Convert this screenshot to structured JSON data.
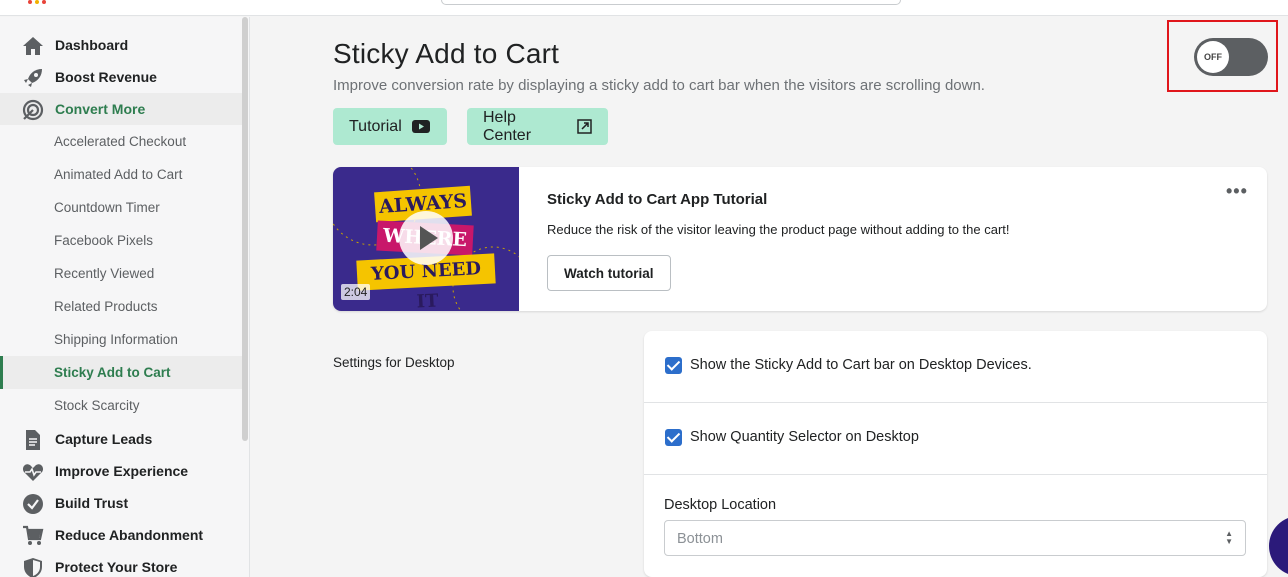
{
  "sidebar": {
    "items": [
      {
        "label": "Dashboard",
        "icon": "home-icon"
      },
      {
        "label": "Boost Revenue",
        "icon": "rocket-icon"
      },
      {
        "label": "Convert More",
        "icon": "target-icon",
        "active": true
      },
      {
        "label": "Capture Leads",
        "icon": "document-icon"
      },
      {
        "label": "Improve Experience",
        "icon": "heartbeat-icon"
      },
      {
        "label": "Build Trust",
        "icon": "badge-check-icon"
      },
      {
        "label": "Reduce Abandonment",
        "icon": "cart-icon"
      },
      {
        "label": "Protect Your Store",
        "icon": "shield-icon"
      }
    ],
    "subitems": [
      "Accelerated Checkout",
      "Animated Add to Cart",
      "Countdown Timer",
      "Facebook Pixels",
      "Recently Viewed",
      "Related Products",
      "Shipping Information",
      "Sticky Add to Cart",
      "Stock Scarcity"
    ],
    "selected_subitem": "Sticky Add to Cart"
  },
  "header": {
    "title": "Sticky Add to Cart",
    "subtitle": "Improve conversion rate by displaying a sticky add to cart bar when the visitors are scrolling down.",
    "tutorial_label": "Tutorial",
    "help_label": "Help Center",
    "toggle_label": "OFF"
  },
  "video_card": {
    "title": "Sticky Add to Cart App Tutorial",
    "description": "Reduce the risk of the visitor leaving the product page without adding to the cart!",
    "button_label": "Watch tutorial",
    "duration": "2:04",
    "thumb_lines": [
      "ALWAYS",
      "WHERE",
      "YOU NEED IT"
    ],
    "more_label": "•••"
  },
  "settings": {
    "section_label": "Settings for Desktop",
    "show_bar_label": "Show the Sticky Add to Cart bar on Desktop Devices.",
    "show_bar_checked": true,
    "show_qty_label": "Show Quantity Selector on Desktop",
    "show_qty_checked": true,
    "location_label": "Desktop Location",
    "location_value": "Bottom"
  },
  "colors": {
    "accent_green": "#2e7d4f",
    "button_green": "#aee9d1",
    "checkbox_blue": "#2c6ecb",
    "highlight_red": "#e0161b"
  }
}
